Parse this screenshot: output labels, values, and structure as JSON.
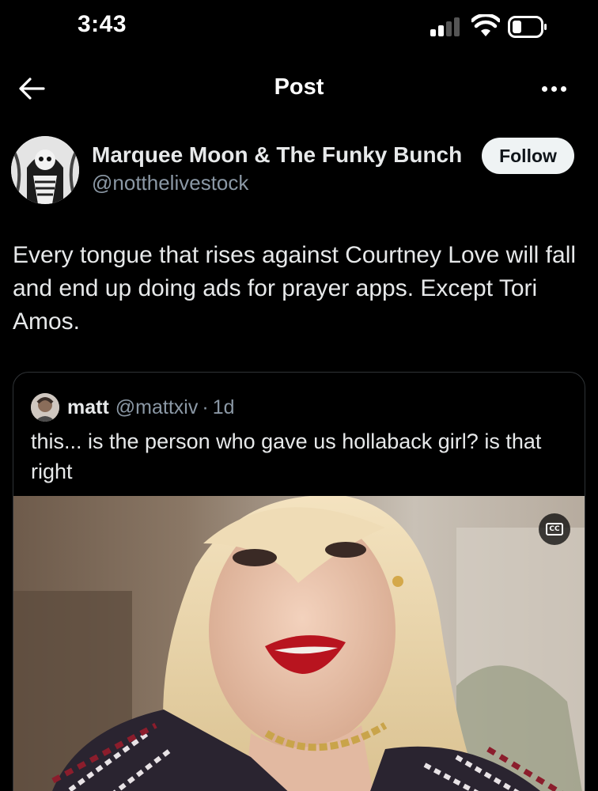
{
  "status_bar": {
    "time": "3:43",
    "icons": [
      "cellular-signal-icon",
      "wifi-icon",
      "battery-icon"
    ]
  },
  "nav": {
    "title": "Post",
    "back_icon": "arrow-left-icon",
    "more_icon": "more-horizontal-icon"
  },
  "post": {
    "author": {
      "display_name": "Marquee Moon & The Funky Bunch",
      "handle": "@notthelivestock"
    },
    "follow_label": "Follow",
    "text": "Every tongue that rises against Courtney Love will fall and end up doing ads for prayer apps. Except Tori Amos.",
    "quote": {
      "author": {
        "display_name": "matt",
        "handle": "@mattxiv"
      },
      "separator": "·",
      "time": "1d",
      "text": "this... is the person who gave us hollaback girl? is that right",
      "media": {
        "type": "video",
        "cc_label": "CC"
      }
    }
  },
  "colors": {
    "background": "#000000",
    "primary_text": "#e7e9ea",
    "secondary_text": "#8b98a5",
    "border": "#2f3336",
    "follow_bg": "#eff3f4",
    "follow_text": "#0f1419"
  }
}
